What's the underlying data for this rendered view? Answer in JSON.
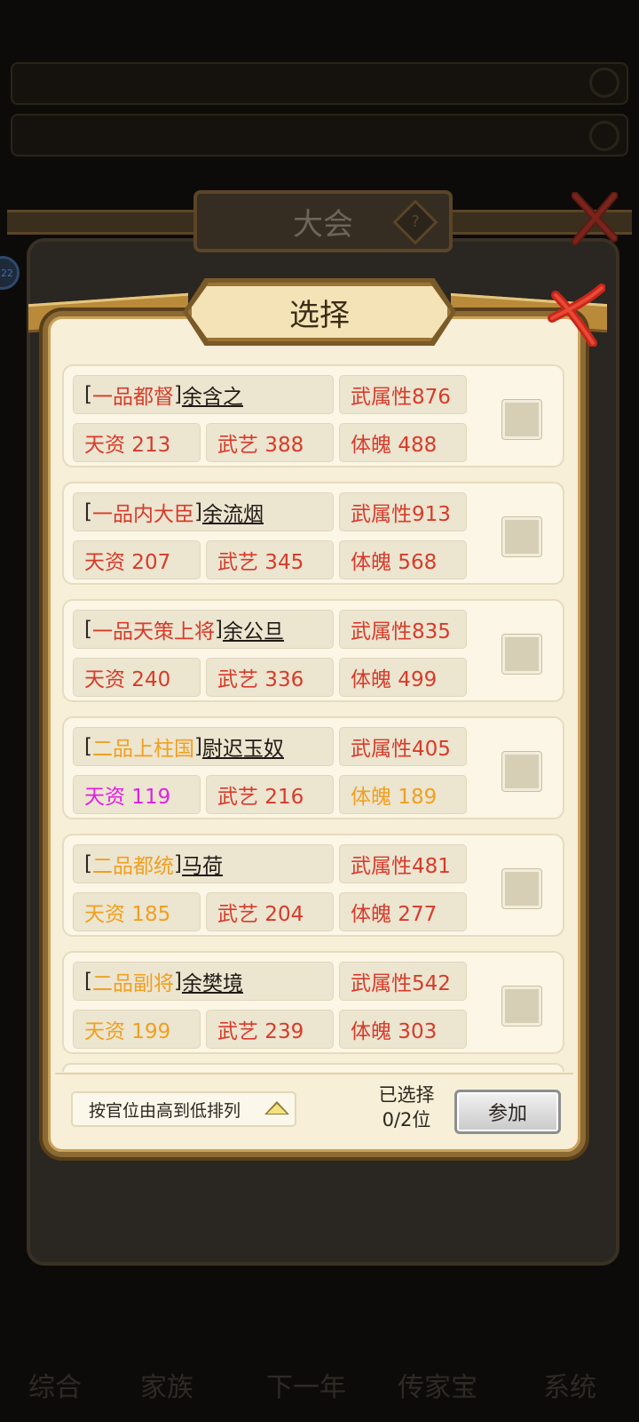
{
  "colors": {
    "red": "#d73b2a",
    "orange": "#f0a020",
    "magenta": "#e020e0",
    "dark": "#2b2620"
  },
  "outer": {
    "title": "大会",
    "help_icon": "?",
    "side_badge": "22"
  },
  "dialog": {
    "title": "选择"
  },
  "members": [
    {
      "rank": "一品都督",
      "rank_color": "#d73b2a",
      "name": "余含之",
      "attr": "武属性876",
      "tianzi": "天资 213",
      "tianzi_color": "#d73b2a",
      "wuyi": "武艺 388",
      "tipo": "体魄 488",
      "tipo_color": "#d73b2a"
    },
    {
      "rank": "一品内大臣",
      "rank_color": "#d73b2a",
      "name": "余流烟",
      "attr": "武属性913",
      "tianzi": "天资 207",
      "tianzi_color": "#d73b2a",
      "wuyi": "武艺 345",
      "tipo": "体魄 568",
      "tipo_color": "#d73b2a"
    },
    {
      "rank": "一品天策上将",
      "rank_color": "#d73b2a",
      "name": "余公旦",
      "attr": "武属性835",
      "tianzi": "天资 240",
      "tianzi_color": "#d73b2a",
      "wuyi": "武艺 336",
      "tipo": "体魄 499",
      "tipo_color": "#d73b2a"
    },
    {
      "rank": "二品上柱国",
      "rank_color": "#f0a020",
      "name": "尉迟玉奴",
      "attr": "武属性405",
      "tianzi": "天资 119",
      "tianzi_color": "#e020e0",
      "wuyi": "武艺 216",
      "tipo": "体魄 189",
      "tipo_color": "#f0a020"
    },
    {
      "rank": "二品都统",
      "rank_color": "#f0a020",
      "name": "马荷",
      "attr": "武属性481",
      "tianzi": "天资 185",
      "tianzi_color": "#f0a020",
      "wuyi": "武艺 204",
      "tipo": "体魄 277",
      "tipo_color": "#d73b2a"
    },
    {
      "rank": "二品副将",
      "rank_color": "#f0a020",
      "name": "余樊境",
      "attr": "武属性542",
      "tianzi": "天资 199",
      "tianzi_color": "#f0a020",
      "wuyi": "武艺 239",
      "tipo": "体魄 303",
      "tipo_color": "#d73b2a"
    }
  ],
  "footer": {
    "sort_label": "按官位由高到低排列",
    "selected_line1": "已选择",
    "selected_line2": "0/2位",
    "join_label": "参加"
  },
  "nav": [
    "综合",
    "家族",
    "下一年",
    "传家宝",
    "系统"
  ]
}
